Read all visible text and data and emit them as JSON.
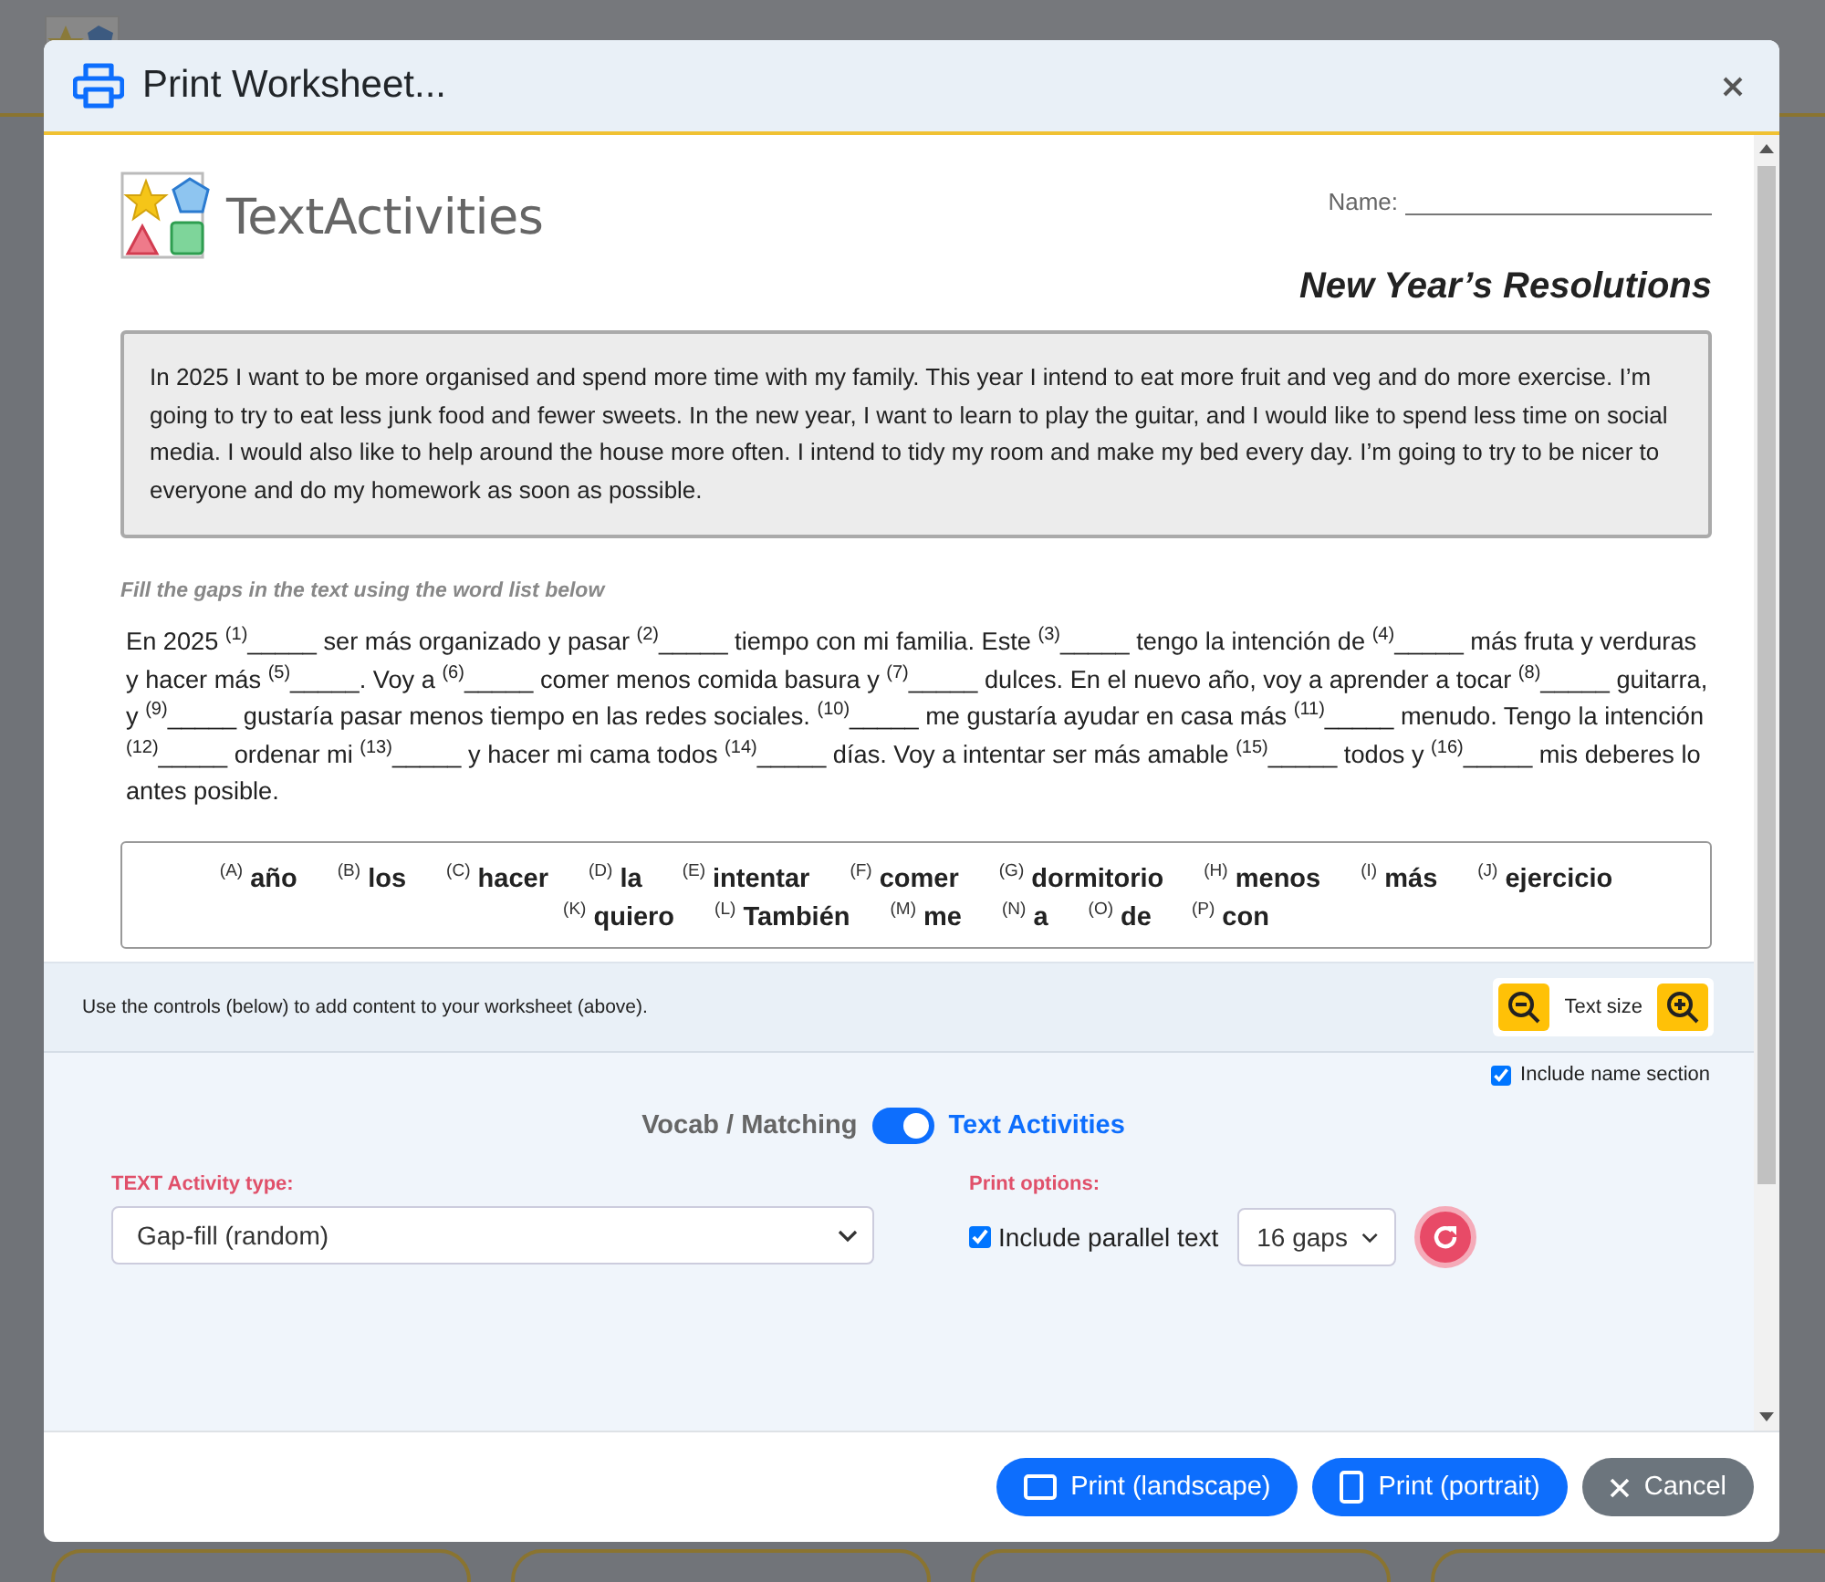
{
  "modal": {
    "title": "Print Worksheet...",
    "worksheet": {
      "brand": "TextActivities",
      "name_label": "Name:",
      "title": "New Year’s Resolutions",
      "passage": "In 2025 I want to be more organised and spend more time with my family. This year I intend to eat more fruit and veg and do more exercise. I’m going to try to eat less junk food and fewer sweets. In the new year, I want to learn to play the guitar, and I would like to spend less time on social media. I would also like to help around the house more often. I intend to tidy my room and make my bed every day. I’m going to try to be nicer to everyone and do my homework as soon as possible.",
      "instruction": "Fill the gaps in the text using the word list below",
      "gap_text": "En 2025 $^{(1)}$_____ ser más organizado y pasar $^{(2)}$_____ tiempo con mi familia. Este $^{(3)}$_____ tengo la intención de $^{(4)}$_____ más fruta y verduras y hacer más $^{(5)}$_____. Voy a $^{(6)}$_____ comer menos comida basura y $^{(7)}$_____ dulces. En el nuevo año, voy a aprender a tocar $^{(8)}$_____ guitarra, y $^{(9)}$_____ gustaría pasar menos tiempo en las redes sociales. $^{(10)}$_____ me gustaría ayudar en casa más $^{(11)}$_____ menudo. Tengo la intención $^{(12)}$_____ ordenar mi $^{(13)}$_____ y hacer mi cama todos $^{(14)}$_____ días. Voy a intentar ser más amable $^{(15)}$_____ todos y $^{(16)}$_____ mis deberes lo antes posible.",
      "word_list": [
        {
          "letter": "(A)",
          "word": "año"
        },
        {
          "letter": "(B)",
          "word": "los"
        },
        {
          "letter": "(C)",
          "word": "hacer"
        },
        {
          "letter": "(D)",
          "word": "la"
        },
        {
          "letter": "(E)",
          "word": "intentar"
        },
        {
          "letter": "(F)",
          "word": "comer"
        },
        {
          "letter": "(G)",
          "word": "dormitorio"
        },
        {
          "letter": "(H)",
          "word": "menos"
        },
        {
          "letter": "(I)",
          "word": "más"
        },
        {
          "letter": "(J)",
          "word": "ejercicio"
        },
        {
          "letter": "(K)",
          "word": "quiero"
        },
        {
          "letter": "(L)",
          "word": "También"
        },
        {
          "letter": "(M)",
          "word": "me"
        },
        {
          "letter": "(N)",
          "word": "a"
        },
        {
          "letter": "(O)",
          "word": "de"
        },
        {
          "letter": "(P)",
          "word": "con"
        }
      ]
    },
    "controls": {
      "hint": "Use the controls (below) to add content to your worksheet (above).",
      "text_size_label": "Text size",
      "include_name": {
        "label": "Include name section",
        "checked": true
      },
      "mode_toggle": {
        "left_label": "Vocab / Matching",
        "right_label": "Text Activities",
        "on": true
      },
      "activity_type": {
        "label": "TEXT Activity type:",
        "value": "Gap-fill (random)"
      },
      "print_options": {
        "label": "Print options:",
        "parallel": {
          "label": "Include parallel text",
          "checked": true
        },
        "gaps": "16 gaps"
      }
    },
    "buttons": [
      "Print (landscape)",
      "Print (portrait)",
      "Cancel"
    ]
  }
}
